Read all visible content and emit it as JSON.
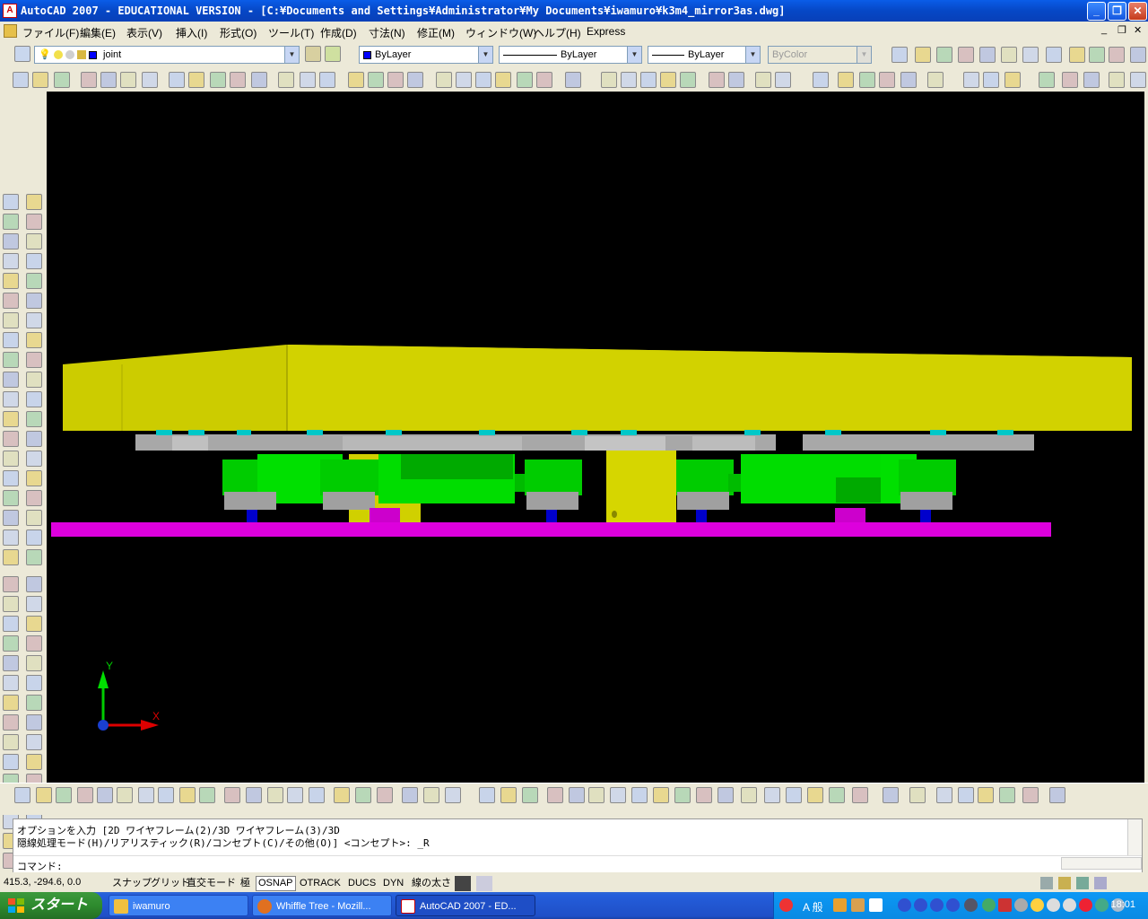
{
  "window": {
    "title": "AutoCAD 2007 - EDUCATIONAL VERSION - [C:¥Documents and Settings¥Administrator¥My Documents¥iwamuro¥k3m4_mirror3as.dwg]",
    "app_icon": "A",
    "minimize_label": "_",
    "maximize_label": "❐",
    "close_label": "✕"
  },
  "menubar": {
    "items": [
      "ファイル(F)",
      "編集(E)",
      "表示(V)",
      "挿入(I)",
      "形式(O)",
      "ツール(T)",
      "作成(D)",
      "寸法(N)",
      "修正(M)",
      "ウィンドウ(W)",
      "ヘルプ(H)",
      "Express"
    ],
    "mdi_buttons": [
      "_",
      "❐",
      "✕"
    ]
  },
  "layers_toolbar": {
    "current_layer": "joint"
  },
  "properties_toolbar": {
    "color": "ByLayer",
    "linetype": "ByLayer",
    "lineweight": "ByLayer",
    "plotstyle": "ByColor"
  },
  "ucs_icon": {
    "y_label": "Y",
    "x_label": "X"
  },
  "command_window": {
    "line1": "オプションを入力 [2D ワイヤフレーム(2)/3D ワイヤフレーム(3)/3D",
    "line2": "隠線処理モード(H)/リアリスティック(R)/コンセプト(C)/その他(O)] <コンセプト>: _R",
    "prompt": "コマンド:"
  },
  "statusbar": {
    "coords": "415.3, -294.6, 0.0",
    "buttons": [
      {
        "label": "スナップ",
        "on": false
      },
      {
        "label": "グリッド",
        "on": false
      },
      {
        "label": "直交モード",
        "on": false
      },
      {
        "label": "極",
        "on": false
      },
      {
        "label": "OSNAP",
        "on": true
      },
      {
        "label": "OTRACK",
        "on": false
      },
      {
        "label": "DUCS",
        "on": false
      },
      {
        "label": "DYN",
        "on": false
      },
      {
        "label": "線の太さ",
        "on": false
      }
    ]
  },
  "taskbar": {
    "start_label": "スタート",
    "tasks": [
      {
        "label": "iwamuro",
        "active": false
      },
      {
        "label": "Whiffle Tree - Mozill...",
        "active": false
      },
      {
        "label": "AutoCAD 2007 - ED...",
        "active": true
      }
    ],
    "ime_label": "A 般",
    "clock": "18:01"
  },
  "colors": {
    "viewport_bg": "#000000",
    "yellow_body": "#cccc00",
    "green_parts": "#00dd00",
    "magenta_base": "#dd00dd",
    "gray_plate": "#a0a0a0"
  }
}
